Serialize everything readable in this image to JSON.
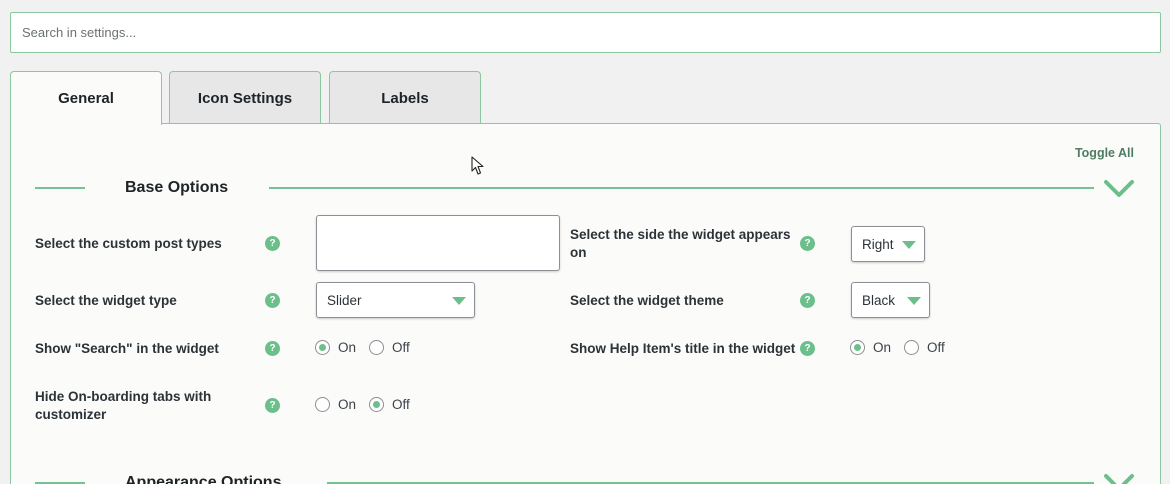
{
  "search": {
    "placeholder": "Search in settings..."
  },
  "tabs": [
    {
      "label": "General",
      "active": true
    },
    {
      "label": "Icon Settings",
      "active": false
    },
    {
      "label": "Labels",
      "active": false
    }
  ],
  "panel": {
    "toggle_all": "Toggle All",
    "sections": [
      {
        "title": "Base Options",
        "chevron_icon": "chevron-down-icon"
      },
      {
        "title": "Appearance Options",
        "chevron_icon": "chevron-down-icon"
      }
    ],
    "help_icon": "?",
    "options": {
      "post_types": {
        "label": "Select the custom post types",
        "value": ""
      },
      "widget_side": {
        "label": "Select the side the widget appears on",
        "value": "Right"
      },
      "widget_type": {
        "label": "Select the widget type",
        "value": "Slider"
      },
      "widget_theme": {
        "label": "Select the widget theme",
        "value": "Black"
      },
      "show_search": {
        "label": "Show \"Search\" in the widget",
        "on": "On",
        "off": "Off",
        "selected": "On"
      },
      "show_help_title": {
        "label": "Show Help Item's title in the widget",
        "on": "On",
        "off": "Off",
        "selected": "On"
      },
      "hide_onboarding": {
        "label": "Hide On-boarding tabs with customizer",
        "on": "On",
        "off": "Off",
        "selected": "Off"
      }
    }
  },
  "colors": {
    "accent": "#6cbf8a",
    "border": "#8cc7a0",
    "link": "#4f7d63"
  }
}
